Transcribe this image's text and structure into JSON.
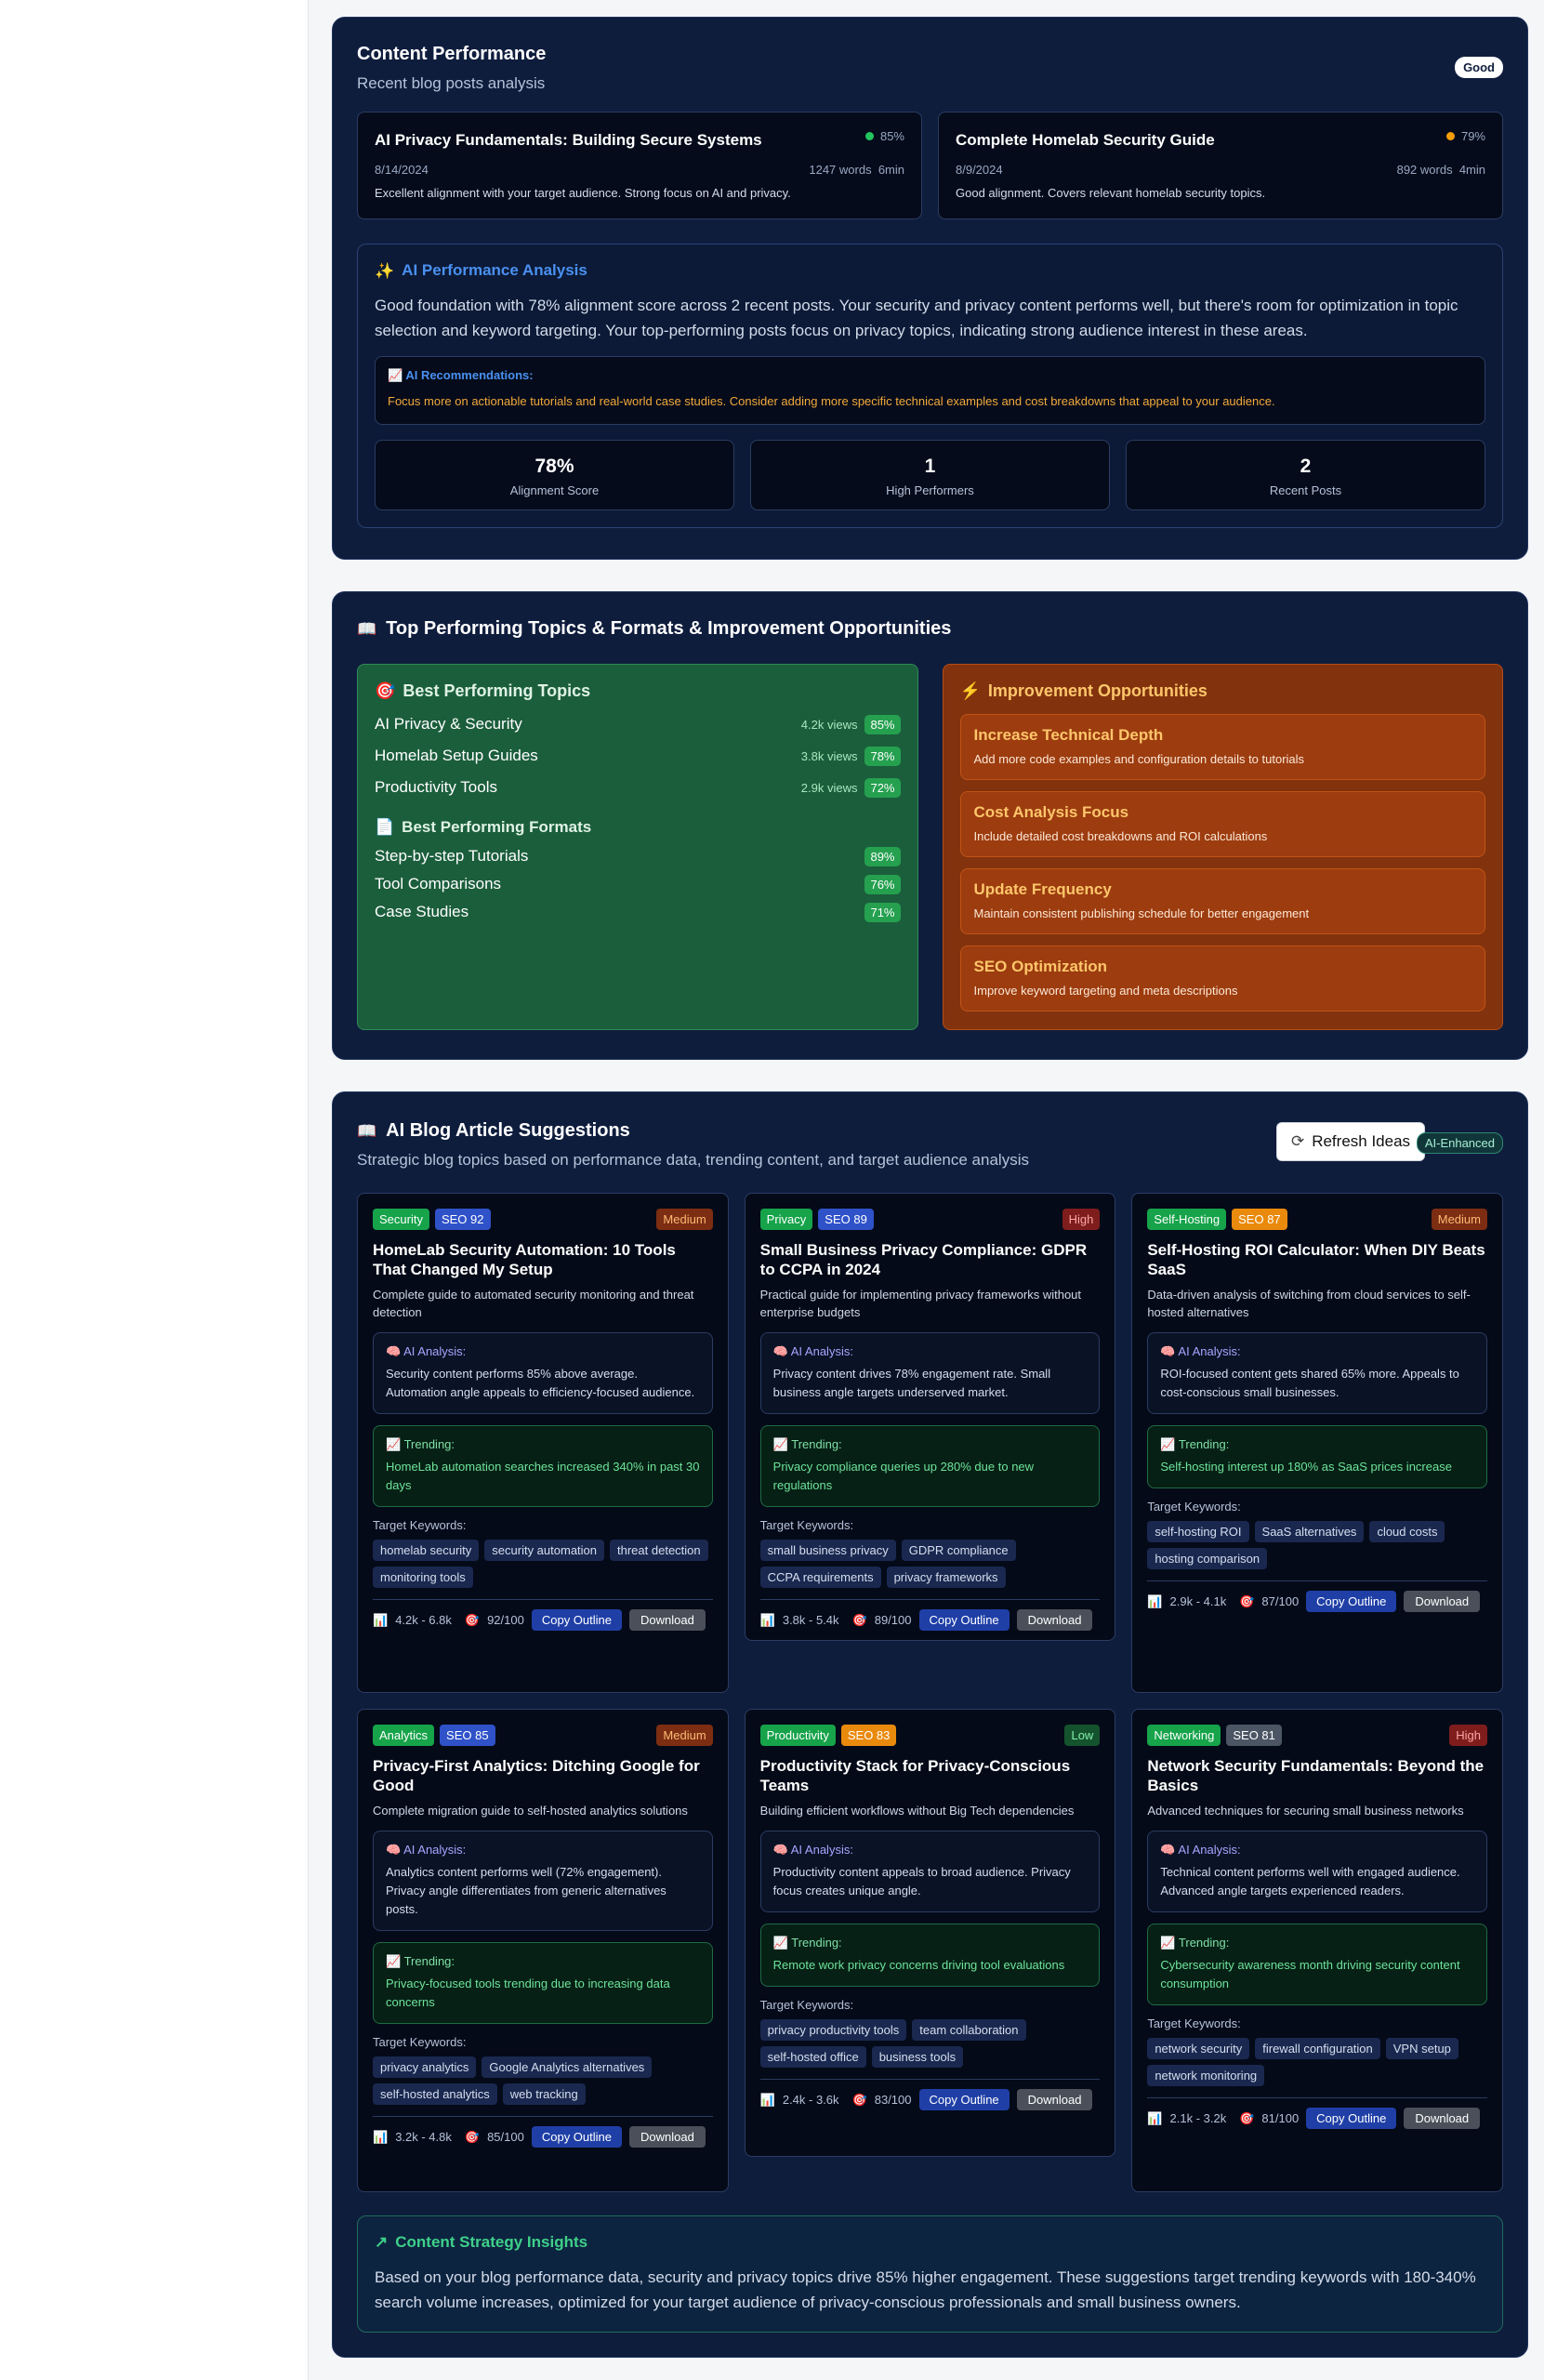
{
  "content_performance": {
    "title": "Content Performance",
    "subtitle": "Recent blog posts analysis",
    "badge": "Good",
    "posts": [
      {
        "title": "AI Privacy Fundamentals: Building Secure Systems",
        "score": "85%",
        "date": "8/14/2024",
        "words": "1247 words",
        "read": "6min",
        "desc": "Excellent alignment with your target audience. Strong focus on AI and privacy.",
        "dot_color": "#22c55e"
      },
      {
        "title": "Complete Homelab Security Guide",
        "score": "79%",
        "date": "8/9/2024",
        "words": "892 words",
        "read": "4min",
        "desc": "Good alignment. Covers relevant homelab security topics.",
        "dot_color": "#f59e0b"
      }
    ],
    "analysis": {
      "title": "AI Performance Analysis",
      "text": "Good foundation with 78% alignment score across 2 recent posts. Your security and privacy content performs well, but there's room for optimization in topic selection and keyword targeting. Your top-performing posts focus on privacy topics, indicating strong audience interest in these areas.",
      "rec_title": "AI Recommendations:",
      "rec_text": "Focus more on actionable tutorials and real-world case studies. Consider adding more specific technical examples and cost breakdowns that appeal to your audience.",
      "stats": [
        {
          "value": "78%",
          "label": "Alignment Score"
        },
        {
          "value": "1",
          "label": "High Performers"
        },
        {
          "value": "2",
          "label": "Recent Posts"
        }
      ]
    }
  },
  "top_topics": {
    "title": "Top Performing Topics & Formats & Improvement Opportunities",
    "best_topics_title": "Best Performing Topics",
    "topics": [
      {
        "name": "AI Privacy & Security",
        "views": "4.2k views",
        "pct": "85%"
      },
      {
        "name": "Homelab Setup Guides",
        "views": "3.8k views",
        "pct": "78%"
      },
      {
        "name": "Productivity Tools",
        "views": "2.9k views",
        "pct": "72%"
      }
    ],
    "best_formats_title": "Best Performing Formats",
    "formats": [
      {
        "name": "Step-by-step Tutorials",
        "pct": "89%"
      },
      {
        "name": "Tool Comparisons",
        "pct": "76%"
      },
      {
        "name": "Case Studies",
        "pct": "71%"
      }
    ],
    "improve_title": "Improvement Opportunities",
    "opportunities": [
      {
        "title": "Increase Technical Depth",
        "desc": "Add more code examples and configuration details to tutorials"
      },
      {
        "title": "Cost Analysis Focus",
        "desc": "Include detailed cost breakdowns and ROI calculations"
      },
      {
        "title": "Update Frequency",
        "desc": "Maintain consistent publishing schedule for better engagement"
      },
      {
        "title": "SEO Optimization",
        "desc": "Improve keyword targeting and meta descriptions"
      }
    ]
  },
  "suggestions": {
    "title": "AI Blog Article Suggestions",
    "subtitle": "Strategic blog topics based on performance data, trending content, and target audience analysis",
    "refresh_label": "Refresh Ideas",
    "badge": "AI-Enhanced",
    "ai_label": "AI Analysis:",
    "trend_label": "Trending:",
    "kw_label": "Target Keywords:",
    "copy_label": "Copy Outline",
    "download_label": "Download",
    "cards": [
      {
        "cat": "Security",
        "cat_color": "#16a34a",
        "seo": "SEO 92",
        "seo_color": "#2f52c9",
        "pri": "Medium",
        "pri_bg": "#7c2d12",
        "pri_fg": "#fdba74",
        "title": "HomeLab Security Automation: 10 Tools That Changed My Setup",
        "desc": "Complete guide to automated security monitoring and threat detection",
        "ai": "Security content performs 85% above average. Automation angle appeals to efficiency-focused audience.",
        "trend": "HomeLab automation searches increased 340% in past 30 days",
        "kws": [
          "homelab security",
          "security automation",
          "threat detection",
          "monitoring tools"
        ],
        "vol": "4.2k - 6.8k",
        "score": "92/100"
      },
      {
        "cat": "Privacy",
        "cat_color": "#16a34a",
        "seo": "SEO 89",
        "seo_color": "#2f52c9",
        "pri": "High",
        "pri_bg": "#7f1d1d",
        "pri_fg": "#fca5a5",
        "title": "Small Business Privacy Compliance: GDPR to CCPA in 2024",
        "desc": "Practical guide for implementing privacy frameworks without enterprise budgets",
        "ai": "Privacy content drives 78% engagement rate. Small business angle targets underserved market.",
        "trend": "Privacy compliance queries up 280% due to new regulations",
        "kws": [
          "small business privacy",
          "GDPR compliance",
          "CCPA requirements",
          "privacy frameworks"
        ],
        "vol": "3.8k - 5.4k",
        "score": "89/100"
      },
      {
        "cat": "Self-Hosting",
        "cat_color": "#16a34a",
        "seo": "SEO 87",
        "seo_color": "#ea8a0c",
        "pri": "Medium",
        "pri_bg": "#7c2d12",
        "pri_fg": "#fdba74",
        "title": "Self-Hosting ROI Calculator: When DIY Beats SaaS",
        "desc": "Data-driven analysis of switching from cloud services to self-hosted alternatives",
        "ai": "ROI-focused content gets shared 65% more. Appeals to cost-conscious small businesses.",
        "trend": "Self-hosting interest up 180% as SaaS prices increase",
        "kws": [
          "self-hosting ROI",
          "SaaS alternatives",
          "cloud costs",
          "hosting comparison"
        ],
        "vol": "2.9k - 4.1k",
        "score": "87/100"
      },
      {
        "cat": "Analytics",
        "cat_color": "#16a34a",
        "seo": "SEO 85",
        "seo_color": "#2f52c9",
        "pri": "Medium",
        "pri_bg": "#7c2d12",
        "pri_fg": "#fdba74",
        "title": "Privacy-First Analytics: Ditching Google for Good",
        "desc": "Complete migration guide to self-hosted analytics solutions",
        "ai": "Analytics content performs well (72% engagement). Privacy angle differentiates from generic alternatives posts.",
        "trend": "Privacy-focused tools trending due to increasing data concerns",
        "kws": [
          "privacy analytics",
          "Google Analytics alternatives",
          "self-hosted analytics",
          "web tracking"
        ],
        "vol": "3.2k - 4.8k",
        "score": "85/100"
      },
      {
        "cat": "Productivity",
        "cat_color": "#16a34a",
        "seo": "SEO 83",
        "seo_color": "#ea8a0c",
        "pri": "Low",
        "pri_bg": "#14532d",
        "pri_fg": "#86efac",
        "title": "Productivity Stack for Privacy-Conscious Teams",
        "desc": "Building efficient workflows without Big Tech dependencies",
        "ai": "Productivity content appeals to broad audience. Privacy focus creates unique angle.",
        "trend": "Remote work privacy concerns driving tool evaluations",
        "kws": [
          "privacy productivity tools",
          "team collaboration",
          "self-hosted office",
          "business tools"
        ],
        "vol": "2.4k - 3.6k",
        "score": "83/100"
      },
      {
        "cat": "Networking",
        "cat_color": "#16a34a",
        "seo": "SEO 81",
        "seo_color": "#4b5563",
        "pri": "High",
        "pri_bg": "#7f1d1d",
        "pri_fg": "#fca5a5",
        "title": "Network Security Fundamentals: Beyond the Basics",
        "desc": "Advanced techniques for securing small business networks",
        "ai": "Technical content performs well with engaged audience. Advanced angle targets experienced readers.",
        "trend": "Cybersecurity awareness month driving security content consumption",
        "kws": [
          "network security",
          "firewall configuration",
          "VPN setup",
          "network monitoring"
        ],
        "vol": "2.1k - 3.2k",
        "score": "81/100"
      }
    ],
    "insights_title": "Content Strategy Insights",
    "insights_text": "Based on your blog performance data, security and privacy topics drive 85% higher engagement. These suggestions target trending keywords with 180-340% search volume increases, optimized for your target audience of privacy-conscious professionals and small business owners."
  }
}
